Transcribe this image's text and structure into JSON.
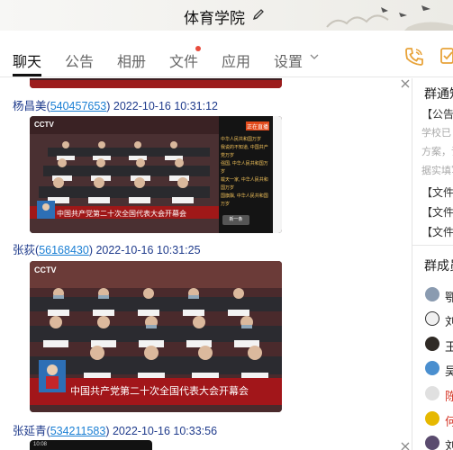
{
  "header": {
    "title": "体育学院"
  },
  "tabs": [
    {
      "label": "聊天",
      "active": true
    },
    {
      "label": "公告"
    },
    {
      "label": "相册"
    },
    {
      "label": "文件",
      "has_dot": true
    },
    {
      "label": "应用"
    },
    {
      "label": "设置"
    }
  ],
  "messages": [
    {
      "name": "杨昌美",
      "id": "540457653",
      "time": "2022-10-16 10:31:12",
      "image": {
        "logo": "CCTV",
        "caption": "中国共产党第二十次全国代表大会开幕会",
        "banner": "正在直播",
        "side_comments": [
          "中华人民共和国万岁",
          "我说的不知道, 中国共产党万岁",
          "强国, 中华人民共和国万岁",
          "载天一家, 中华人民共和国万岁",
          "国旗飘, 中华人民共和国万岁"
        ],
        "side_button": "新一条"
      }
    },
    {
      "name": "张荻",
      "id": "56168430",
      "time": "2022-10-16 10:31:25",
      "image": {
        "logo": "CCTV",
        "caption": "中国共产党第二十次全国代表大会开幕会"
      }
    },
    {
      "name": "张延青",
      "id": "534211583",
      "time": "2022-10-16 10:33:56",
      "image": {
        "status_time": "10:08"
      }
    }
  ],
  "panel": {
    "notice_title": "群通知",
    "notice_lines": [
      "【公告】",
      "学校已",
      "方案，请",
      "据实填写"
    ],
    "file_lines": [
      "【文件】",
      "【文件】",
      "【文件】"
    ],
    "members_title": "群成员",
    "members": [
      {
        "name": "鄂",
        "color": "#8a9bb0"
      },
      {
        "name": "刘",
        "color": "#3a3a3a"
      },
      {
        "name": "王",
        "color": "#2f2a25"
      },
      {
        "name": "吴",
        "color": "#4a8fcf"
      },
      {
        "name": "陈",
        "color": "#c0392b"
      },
      {
        "name": "何",
        "color": "#e6b800"
      },
      {
        "name": "刘",
        "color": "#5a4b6e"
      }
    ]
  },
  "colors": {
    "accent_link": "#1a7fd4",
    "sender_name": "#1f3b8c",
    "notification_dot": "#e84c3d",
    "phone_icon": "#e8a33a",
    "red_name": "#d63b2c"
  }
}
